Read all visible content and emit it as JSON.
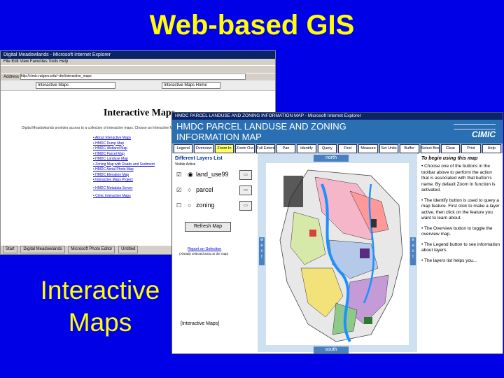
{
  "slide": {
    "title": "Web-based GIS",
    "caption_line1": "Interactive",
    "caption_line2": "Maps"
  },
  "back_window": {
    "title": "Digital Meadowlands - Microsoft Internet Explorer",
    "menu": "File  Edit  View  Favorites  Tools  Help",
    "address_label": "Address",
    "address_value": "http://cimic.rutgers.edu/~dm/interactive_maps",
    "site_select": "Interactive Maps",
    "nav_select": "Interactive Maps Home",
    "heading": "Interactive Maps",
    "intro": "Digital Meadowlands provides access to a collection of interactive maps. Choose an Interactive Map from the selection list.",
    "links": [
      "About Interactive Maps",
      "HMDC Dump Map",
      "HMDC Wetland Map",
      "HMDC Parcel Map",
      "HMDC Landuse Map",
      "Zoning Map with Roads and Sediment",
      "HMDC Aerial Photo Map",
      "HMDC Elevation Map",
      "Interactive Maps Project",
      "HMDC Metadata Server",
      "Cimic Interactive Maps"
    ],
    "taskbar": [
      "Start",
      "Digital Meadowlands",
      "Microsoft Photo Editor",
      "Untitled"
    ]
  },
  "front_window": {
    "title": "HMDC PARCEL LANDUSE AND ZONING INFORMATION MAP - Microsoft Internet Explorer",
    "banner_line1": "HMDC PARCEL LANDUSE AND ZONING",
    "banner_line2": "INFORMATION MAP",
    "logo": "CIMIC",
    "toolbar": [
      "Legend",
      "Overview",
      "Zoom In",
      "Zoom Out",
      "Full Extent",
      "Pan",
      "Identify",
      "Query",
      "Find",
      "Measure",
      "Set Units",
      "Buffer",
      "Select Box",
      "Clear",
      "Print",
      "Help"
    ],
    "active_tool": "Zoom In",
    "layers_title": "Different Layers List",
    "layers_header": "Visible Active",
    "layers": [
      {
        "name": "land_use99"
      },
      {
        "name": "parcel"
      },
      {
        "name": "zoning"
      }
    ],
    "refresh_label": "Refresh Map",
    "report_link": "Report on Selection",
    "report_note": "(Already selected area on the map)",
    "selection_label": "[Interactive Maps]",
    "nav": {
      "north": "north",
      "south": "south",
      "west": "west",
      "east": "east"
    },
    "help_heading": "To begin using this map",
    "help_items": [
      "Choose one of the buttons in the toolbar above to perform the action that is associated with that button's name. By default Zoom In function is activated.",
      "The Identify button is used to query a map feature. First click to make a layer active, then click on the feature you want to learn about.",
      "The Overview button to toggle the overview map.",
      "The Legend button to see information about layers.",
      "The layers list helps you..."
    ],
    "colors": {
      "banner": "#2b6fb3",
      "toolbar": "#9bb7d4",
      "map_frame": "#cfe0f0"
    }
  }
}
